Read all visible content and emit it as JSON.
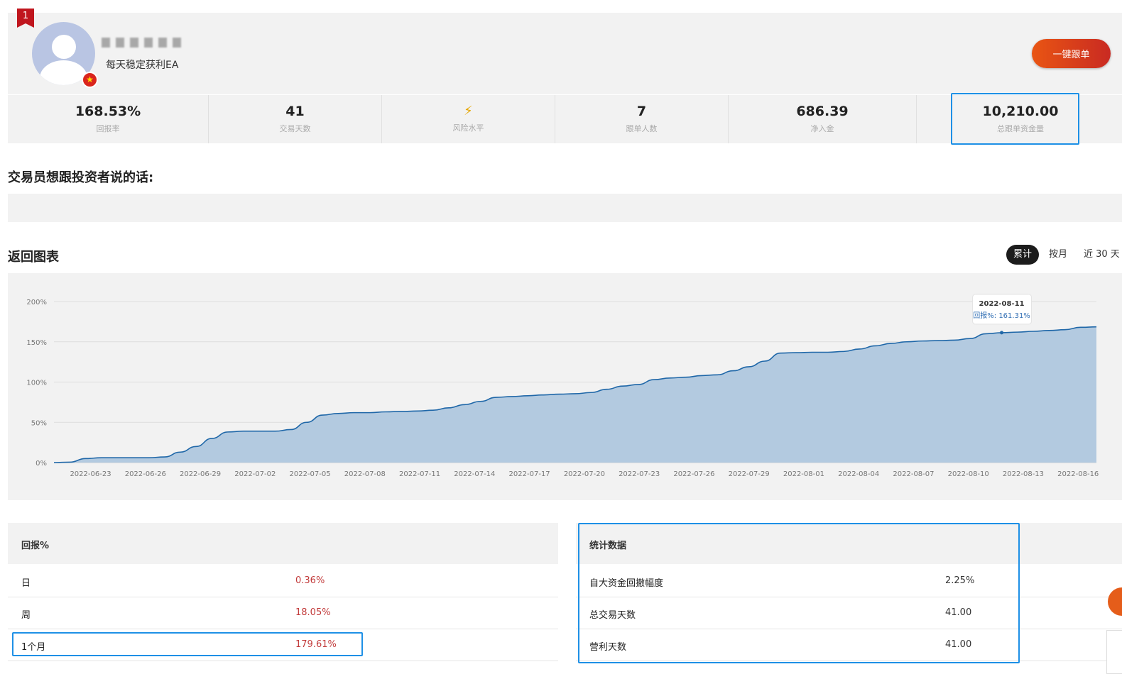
{
  "profile": {
    "rank": "1",
    "subtitle": "每天稳定获利EA",
    "follow_button": "一键跟单"
  },
  "stats": [
    {
      "value": "168.53%",
      "label": "回报率"
    },
    {
      "value": "41",
      "label": "交易天数"
    },
    {
      "value": "⚡",
      "label": "风险水平"
    },
    {
      "value": "7",
      "label": "跟单人数"
    },
    {
      "value": "686.39",
      "label": "净入金"
    },
    {
      "value": "10,210.00",
      "label": "总跟单资金量"
    }
  ],
  "message": {
    "title": "交易员想跟投资者说的话:"
  },
  "chart_section": {
    "title": "返回图表",
    "tabs": [
      "累计",
      "按月",
      "近 30 天"
    ]
  },
  "chart_data": {
    "type": "area",
    "ylim": [
      0,
      200
    ],
    "y_ticks": [
      "0%",
      "50%",
      "100%",
      "150%",
      "200%"
    ],
    "x_ticks": [
      "2022-06-23",
      "2022-06-26",
      "2022-06-29",
      "2022-07-02",
      "2022-07-05",
      "2022-07-08",
      "2022-07-11",
      "2022-07-14",
      "2022-07-17",
      "2022-07-20",
      "2022-07-23",
      "2022-07-26",
      "2022-07-29",
      "2022-08-01",
      "2022-08-04",
      "2022-08-07",
      "2022-08-10",
      "2022-08-13",
      "2022-08-16"
    ],
    "x": [
      "2022-06-21",
      "2022-06-22",
      "2022-06-23",
      "2022-06-24",
      "2022-06-25",
      "2022-06-26",
      "2022-06-27",
      "2022-06-28",
      "2022-06-29",
      "2022-06-30",
      "2022-07-01",
      "2022-07-02",
      "2022-07-03",
      "2022-07-04",
      "2022-07-05",
      "2022-07-06",
      "2022-07-07",
      "2022-07-08",
      "2022-07-09",
      "2022-07-10",
      "2022-07-11",
      "2022-07-12",
      "2022-07-13",
      "2022-07-14",
      "2022-07-15",
      "2022-07-16",
      "2022-07-17",
      "2022-07-18",
      "2022-07-19",
      "2022-07-20",
      "2022-07-21",
      "2022-07-22",
      "2022-07-23",
      "2022-07-24",
      "2022-07-25",
      "2022-07-26",
      "2022-07-27",
      "2022-07-28",
      "2022-07-29",
      "2022-07-30",
      "2022-07-31",
      "2022-08-01",
      "2022-08-02",
      "2022-08-03",
      "2022-08-04",
      "2022-08-05",
      "2022-08-06",
      "2022-08-07",
      "2022-08-08",
      "2022-08-09",
      "2022-08-10",
      "2022-08-11",
      "2022-08-12",
      "2022-08-13",
      "2022-08-14",
      "2022-08-15",
      "2022-08-16",
      "2022-08-17"
    ],
    "series": [
      {
        "values": [
          0,
          0.5,
          5,
          6,
          6,
          6,
          6,
          7,
          13,
          20,
          30,
          38,
          39,
          39,
          39,
          41,
          50,
          59,
          61,
          62,
          62,
          63,
          63.5,
          64,
          65,
          68,
          72,
          76,
          81,
          82,
          83,
          84,
          85,
          85.5,
          87,
          91,
          95,
          97,
          103,
          105,
          106,
          108,
          109,
          114,
          119,
          126,
          136,
          136.5,
          137,
          137,
          138,
          141,
          145,
          148,
          150,
          151,
          151.5,
          152,
          154,
          160,
          161.31,
          162,
          163,
          164,
          165,
          168,
          168.53
        ],
        "fill": "#b3cae0",
        "stroke": "#1f67a8"
      }
    ],
    "tooltip": {
      "date": "2022-08-11",
      "label": "回报%: 161.31%"
    }
  },
  "returns_table": {
    "header": "回报%",
    "rows": [
      {
        "label": "日",
        "value": "0.36%"
      },
      {
        "label": "周",
        "value": "18.05%"
      },
      {
        "label": "1个月",
        "value": "179.61%"
      }
    ]
  },
  "stats_table": {
    "header": "统计数据",
    "rows": [
      {
        "label": "自大资金回撤幅度",
        "value": "2.25%"
      },
      {
        "label": "总交易天数",
        "value": "41.00"
      },
      {
        "label": "营利天数",
        "value": "41.00"
      }
    ]
  }
}
